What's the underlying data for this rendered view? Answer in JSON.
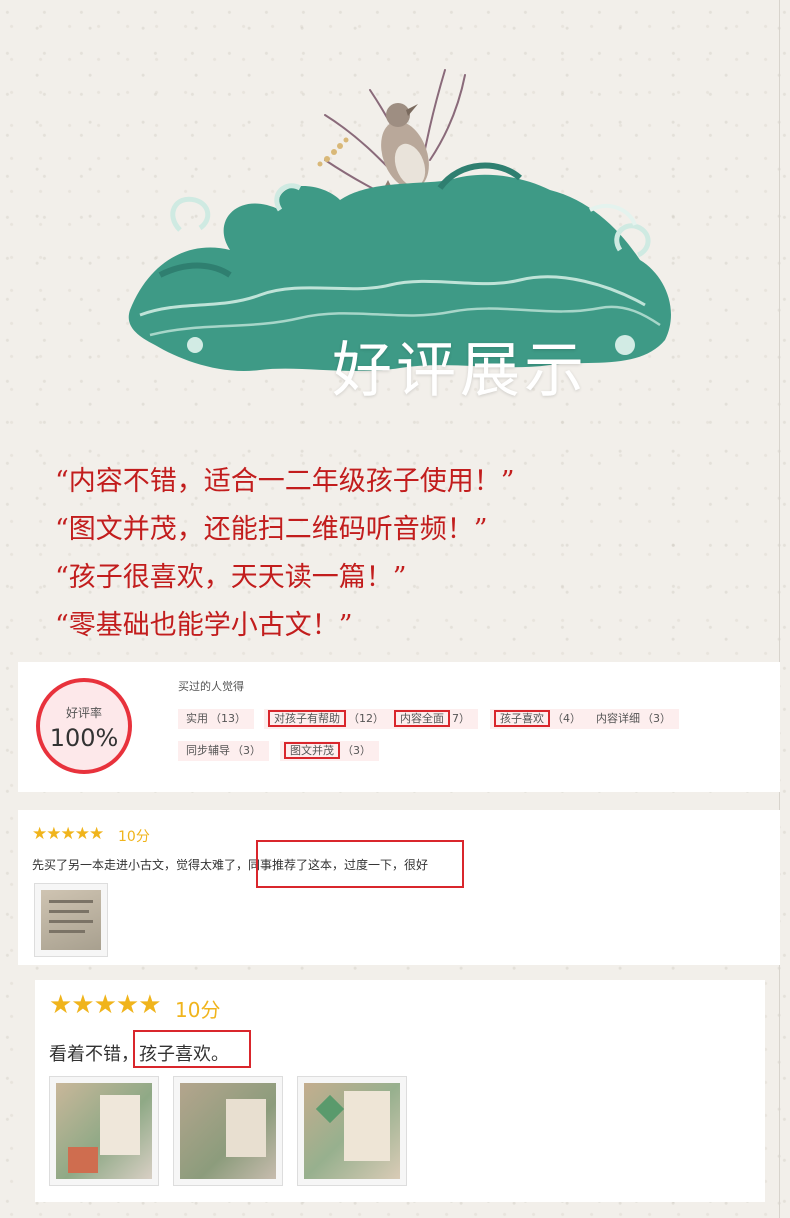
{
  "hero": {
    "title": "好评展示"
  },
  "quotes": [
    "“内容不错，适合一二年级孩子使用！”",
    "“图文并茂，还能扫二维码听音频！”",
    "“孩子很喜欢，天天读一篇！”",
    "“零基础也能学小古文！”"
  ],
  "summary": {
    "rate_label": "好评率",
    "rate_value": "100%",
    "buyers_label": "买过的人觉得",
    "tags": [
      {
        "label": "实用",
        "count": "（13）"
      },
      {
        "label": "对孩子有帮助",
        "count": "（12）"
      },
      {
        "label": "内容全面",
        "count": "7）"
      },
      {
        "label": "孩子喜欢",
        "count": "（4）"
      },
      {
        "label": "内容详细",
        "count": "（3）"
      },
      {
        "label": "同步辅导",
        "count": "（3）"
      },
      {
        "label": "图文并茂",
        "count": "（3）"
      }
    ]
  },
  "reviews": [
    {
      "stars": "★★★★★",
      "score": "10分",
      "text": "先买了另一本走进小古文，觉得太难了，同事推荐了这本，过度一下，很好"
    },
    {
      "stars": "★★★★★",
      "score": "10分",
      "text": "看着不错，孩子喜欢。"
    }
  ],
  "colors": {
    "accent_red": "#c21d1d",
    "box_red": "#d9262c",
    "star_gold": "#f0b41c",
    "wave_teal": "#3b9a88"
  }
}
